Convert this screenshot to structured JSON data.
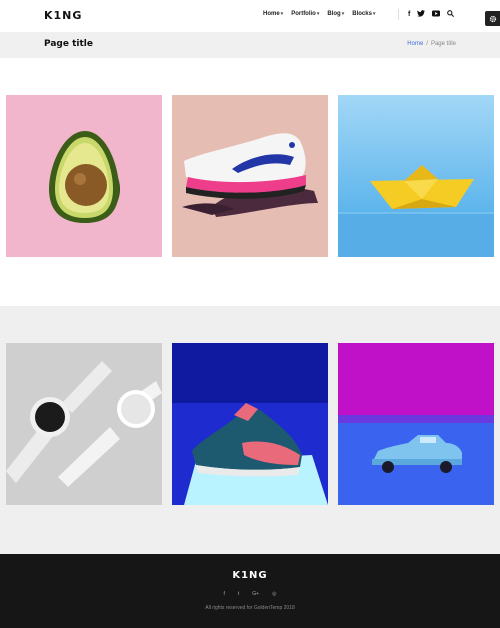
{
  "header": {
    "logo": "K1NG",
    "nav": [
      {
        "label": "Home"
      },
      {
        "label": "Portfolio"
      },
      {
        "label": "Blog"
      },
      {
        "label": "Blocks"
      }
    ],
    "social": [
      "f",
      "t",
      "▶",
      "⌕"
    ]
  },
  "titlebar": {
    "title": "Page title",
    "breadcrumb_home": "Home",
    "breadcrumb_sep": "/",
    "breadcrumb_current": "Page title"
  },
  "gallery": {
    "tiles": [
      {
        "subject": "avocado-half",
        "bg": "#f2b6cc"
      },
      {
        "subject": "sneaker-on-hand",
        "bg": "#e5bdb3"
      },
      {
        "subject": "yellow-paper-boat",
        "bg": "#7fc6f0"
      },
      {
        "subject": "white-smartwatches",
        "bg": "#cfcfcf"
      },
      {
        "subject": "blue-sneaker",
        "bg": "#1f2fd8"
      },
      {
        "subject": "toy-car",
        "bg": "#c010c8"
      }
    ]
  },
  "footer": {
    "logo": "K1NG",
    "social": [
      "f",
      "t",
      "G+",
      "◎"
    ],
    "copyright": "All rights reserved for GoldenTemp 2018"
  },
  "colors": {
    "accent": "#3d6fd8",
    "footer_bg": "#161616",
    "titlebar_bg": "#f0f0f0"
  }
}
